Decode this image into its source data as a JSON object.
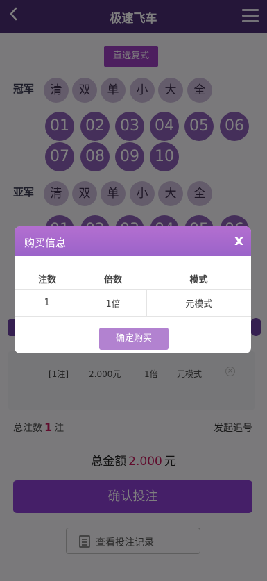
{
  "header": {
    "title": "极速飞车"
  },
  "mode_button": "直选复式",
  "rows": [
    {
      "label": "冠军",
      "quick": [
        "清",
        "双",
        "单",
        "小",
        "大",
        "全"
      ],
      "numbers": [
        "01",
        "02",
        "03",
        "04",
        "05",
        "06",
        "07",
        "08",
        "09",
        "10"
      ]
    },
    {
      "label": "亚军",
      "quick": [
        "清",
        "双",
        "单",
        "小",
        "大",
        "全"
      ],
      "numbers": [
        "01",
        "02",
        "03",
        "04",
        "05",
        "06"
      ]
    }
  ],
  "bet_item": {
    "count": "[1注]",
    "amount": "2.000元",
    "multiple": "1倍",
    "mode": "元模式",
    "delete_icon": "close-circle-icon"
  },
  "summary": {
    "count_prefix": "总注数",
    "count_value": "1",
    "count_suffix": "注",
    "chase_link": "发起追号",
    "amount_prefix": "总金额",
    "amount_value": "2.000",
    "amount_suffix": "元"
  },
  "confirm_bet": "确认投注",
  "history_button": "查看投注记录",
  "dialog": {
    "title": "购买信息",
    "close": "x",
    "columns": [
      "注数",
      "倍数",
      "模式"
    ],
    "row": [
      "1",
      "1倍",
      "元模式"
    ],
    "confirm": "确定购买"
  },
  "colors": {
    "header": "#4b2c73",
    "accent": "#8a3fd0",
    "dialog_header": "#b36fd0",
    "highlight": "#c2185b"
  }
}
